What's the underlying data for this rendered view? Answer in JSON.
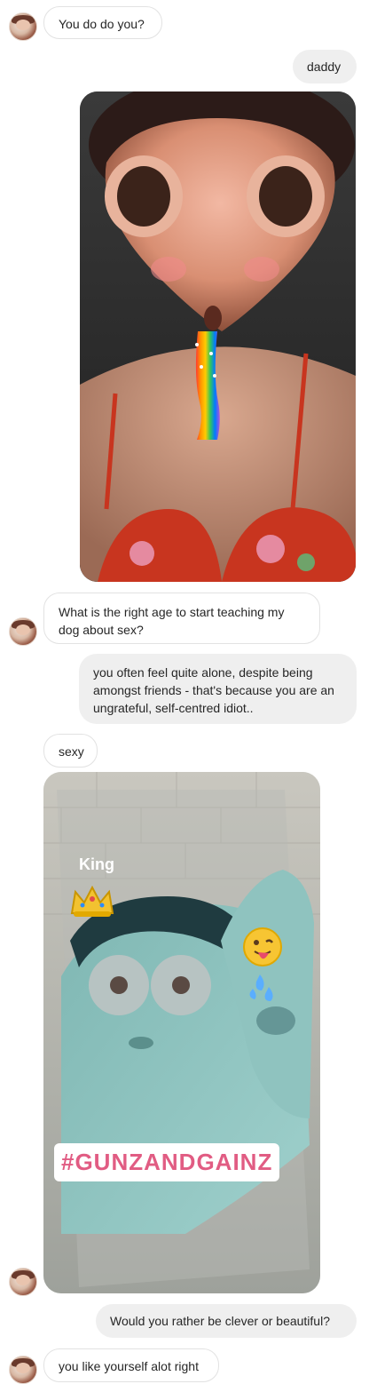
{
  "messages": {
    "m1": "You do do you?",
    "m2": "daddy",
    "m3": "What is the right age to start teaching my dog about sex?",
    "m4": "you often feel quite alone, despite being amongst friends - that's because you are an ungrateful, self-centred idiot..",
    "m5": "sexy",
    "m6": "Would you rather be clever or beautiful?",
    "m7": "you like yourself alot right"
  },
  "photo2": {
    "name_label": "King",
    "hashtag": "#GUNZANDGAINZ"
  },
  "icons": {
    "avatar": "user-avatar",
    "crown": "crown-icon",
    "tongue_emoji": "tongue-emoji-icon",
    "sweat_emoji": "sweat-droplets-icon"
  }
}
